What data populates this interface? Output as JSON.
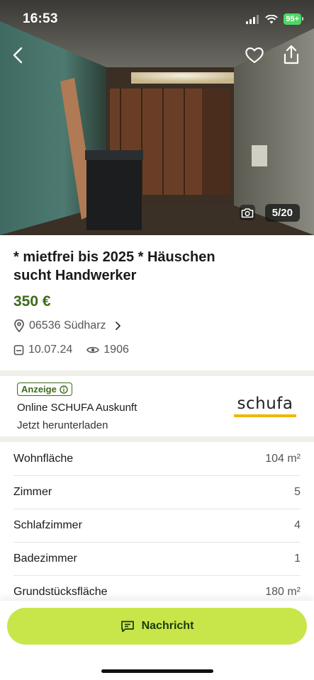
{
  "status_bar": {
    "time": "16:53",
    "battery": "95+"
  },
  "gallery": {
    "counter": "5/20"
  },
  "listing": {
    "title": "* mietfrei bis 2025 * Häuschen sucht Handwerker",
    "price": "350 €",
    "location": "06536 Südharz",
    "date": "10.07.24",
    "views": "1906"
  },
  "ad": {
    "badge": "Anzeige",
    "title": "Online SCHUFA Auskunft",
    "subtitle": "Jetzt herunterladen",
    "logo_text": "schufa"
  },
  "details": [
    {
      "label": "Wohnfläche",
      "value": "104 m²"
    },
    {
      "label": "Zimmer",
      "value": "5"
    },
    {
      "label": "Schlafzimmer",
      "value": "4"
    },
    {
      "label": "Badezimmer",
      "value": "1"
    },
    {
      "label": "Grundstücksfläche",
      "value": "180 m²"
    }
  ],
  "cta": {
    "label": "Nachricht"
  },
  "colors": {
    "price": "#3d6b1a",
    "cta": "#c8e64a",
    "schufa_yellow": "#f2b600"
  },
  "icons": [
    "back-icon",
    "heart-icon",
    "share-icon",
    "camera-icon",
    "location-pin-icon",
    "chevron-right-icon",
    "calendar-icon",
    "eye-icon",
    "info-icon",
    "message-icon"
  ]
}
